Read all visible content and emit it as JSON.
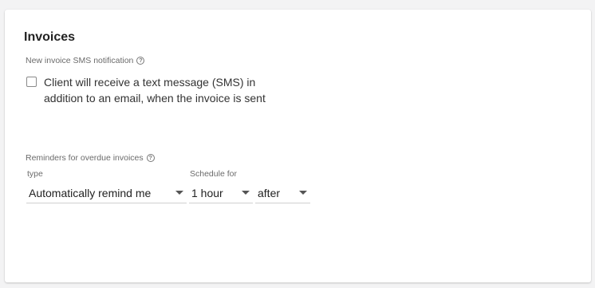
{
  "invoices": {
    "title": "Invoices",
    "sms_section_label": "New invoice SMS notification",
    "sms_checkbox_label": "Client will receive a text message (SMS) in addition to an email, when the invoice is sent",
    "sms_checked": false,
    "reminders_section_label": "Reminders for overdue invoices",
    "type_label": "type",
    "type_value": "Automatically remind me",
    "schedule_label": "Schedule for",
    "schedule_value": "1 hour",
    "timing_value": "after"
  },
  "icons": {
    "help": "help-circle-icon",
    "dropdown": "caret-down-icon"
  },
  "colors": {
    "background": "#f3f3f4",
    "card": "#ffffff",
    "muted_text": "#6b6b6b"
  }
}
